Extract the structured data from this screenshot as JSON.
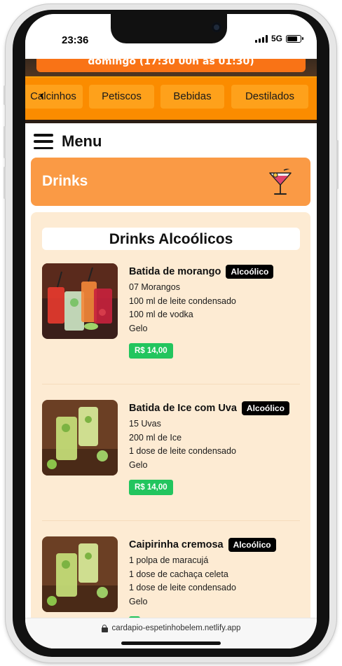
{
  "status_bar": {
    "time": "23:36",
    "network": "5G",
    "battery_level": 0.8,
    "signal_bars": 4
  },
  "header": {
    "hours_text": "domingo (17:30 00h às 01:30)",
    "categories": [
      "Calcinhos",
      "Petiscos",
      "Bebidas",
      "Destilados"
    ]
  },
  "menu": {
    "title": "Menu"
  },
  "section": {
    "title": "Drinks",
    "icon": "cocktail-icon"
  },
  "subsection": {
    "title": "Drinks Alcoólicos"
  },
  "items": [
    {
      "name": "Batida de morango",
      "badge": "Alcoólico",
      "ingredients": [
        "07 Morangos",
        "100 ml de leite condensado",
        "100 ml de vodka",
        "Gelo"
      ],
      "price": "R$ 14,00"
    },
    {
      "name": "Batida de Ice com Uva",
      "badge": "Alcoólico",
      "ingredients": [
        "15 Uvas",
        "200 ml de Ice",
        "1 dose de leite condensado",
        "Gelo"
      ],
      "price": "R$ 14,00"
    },
    {
      "name": "Caipirinha cremosa",
      "badge": "Alcoólico",
      "ingredients": [
        "1 polpa de maracujá",
        "1 dose de cachaça celeta",
        "1 dose de leite condensado",
        "Gelo"
      ],
      "price": ""
    }
  ],
  "browser": {
    "url": "cardapio-espetinhobelem.netlify.app"
  },
  "colors": {
    "accent_orange": "#fb8c00",
    "section_orange": "#fa9a45",
    "content_bg": "#fdebd3",
    "price_green": "#22c55e",
    "badge_black": "#000000"
  }
}
